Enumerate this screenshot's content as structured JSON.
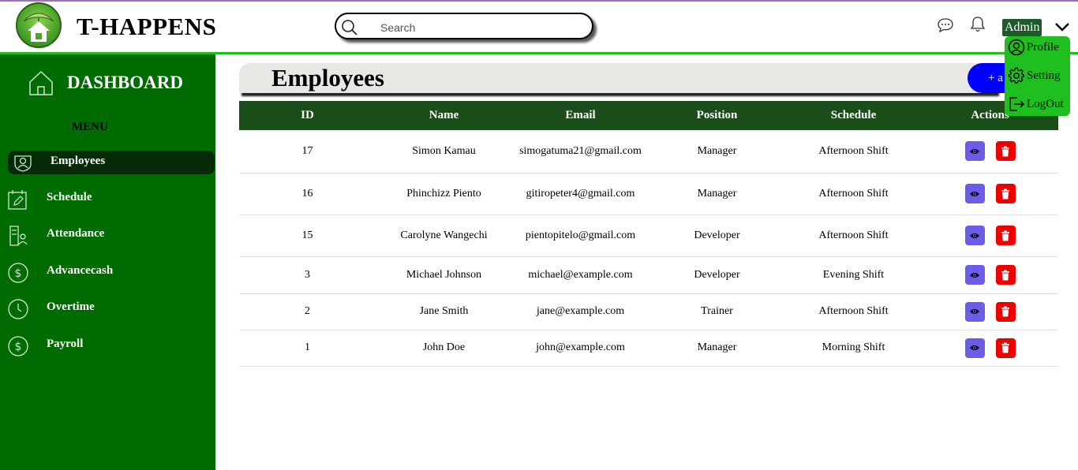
{
  "header": {
    "brand": "T-HAPPENS",
    "search_placeholder": "Search",
    "user_label": "Admin"
  },
  "user_menu": [
    {
      "label": "Profile",
      "icon": "user-circle-icon"
    },
    {
      "label": "Setting",
      "icon": "gear-icon"
    },
    {
      "label": "LogOut",
      "icon": "logout-icon"
    }
  ],
  "sidebar": {
    "dashboard_label": "DASHBOARD",
    "menu_label": "MENU",
    "items": [
      {
        "label": "Employees",
        "icon": "employee-badge-icon",
        "active": true
      },
      {
        "label": "Schedule",
        "icon": "calendar-edit-icon"
      },
      {
        "label": "Attendance",
        "icon": "attendance-icon"
      },
      {
        "label": "Advancecash",
        "icon": "dollar-icon"
      },
      {
        "label": "Overtime",
        "icon": "clock-icon"
      },
      {
        "label": "Payroll",
        "icon": "dollar-icon"
      }
    ]
  },
  "main": {
    "title": "Employees",
    "add_button_label": "+ a"
  },
  "table": {
    "columns": [
      "ID",
      "Name",
      "Email",
      "Position",
      "Schedule",
      "Actions"
    ],
    "rows": [
      {
        "id": "17",
        "name": "Simon Kamau",
        "email": "simogatuma21@gmail.com",
        "position": "Manager",
        "schedule": "Afternoon Shift"
      },
      {
        "id": "16",
        "name": "Phinchizz Piento",
        "email": "gitiropeter4@gmail.com",
        "position": "Manager",
        "schedule": "Afternoon Shift"
      },
      {
        "id": "15",
        "name": "Carolyne Wangechi",
        "email": "pientopitelo@gmail.com",
        "position": "Developer",
        "schedule": "Afternoon Shift"
      },
      {
        "id": "3",
        "name": "Michael Johnson",
        "email": "michael@example.com",
        "position": "Developer",
        "schedule": "Evening Shift"
      },
      {
        "id": "2",
        "name": "Jane Smith",
        "email": "jane@example.com",
        "position": "Trainer",
        "schedule": "Afternoon Shift"
      },
      {
        "id": "1",
        "name": "John Doe",
        "email": "john@example.com",
        "position": "Manager",
        "schedule": "Morning Shift"
      }
    ]
  },
  "colors": {
    "sidebar": "#006b00",
    "table_header": "#1a4d1a",
    "view_button": "#6c5ce7",
    "delete_button": "#ee0000",
    "add_button": "#0000ff",
    "accent_border": "#1fbf1f"
  }
}
